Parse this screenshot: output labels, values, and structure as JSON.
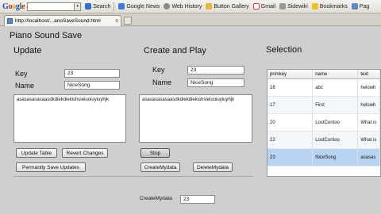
{
  "google_toolbar": {
    "search_button": "Search",
    "items": [
      "Google News",
      "Web History",
      "Button Gallery",
      "Gmail",
      "Sidewiki",
      "Bookmarks",
      "Pag"
    ]
  },
  "tab": {
    "url": "http://localhost/...anoSaveSound.html",
    "close": "x"
  },
  "app": {
    "title": "Piano Sound Save"
  },
  "update": {
    "title": "Update",
    "key_label": "Key",
    "key_value": "23",
    "name_label": "Name",
    "name_value": "NiceSong",
    "text_value": "asasasasasaasdkdiekdiekishsieiuoiuyiuyhjk",
    "update_table_button": "Update Table",
    "revert_changes_button": "Revert Changes",
    "permanently_save_button": "Permantly Save Updates"
  },
  "create": {
    "title": "Create and Play",
    "key_label": "Key",
    "key_value": "23",
    "name_label": "Name",
    "name_value": "NiceSong",
    "text_value": "asasasasasaasdkdiekdiekishsieiuoiuyiuyhjk",
    "stop_button": "Stop",
    "create_button": "CreateMydata",
    "delete_button": "DeleteMydata",
    "created_label": "CreateMydata",
    "created_value": "23"
  },
  "selection": {
    "title": "Selection",
    "columns": [
      "primkey",
      "name",
      "text"
    ],
    "rows": [
      {
        "primkey": "16",
        "name": "abc",
        "text": "helowh"
      },
      {
        "primkey": "17",
        "name": "First",
        "text": "helowh"
      },
      {
        "primkey": "20",
        "name": "LostContoo",
        "text": "What is"
      },
      {
        "primkey": "22",
        "name": "LostContoo",
        "text": "What is"
      },
      {
        "primkey": "23",
        "name": "NiceSong",
        "text": "asasas"
      }
    ]
  },
  "colors": {
    "selected_row": "#b9d3f2",
    "page_bg": "#cfcfcf"
  }
}
